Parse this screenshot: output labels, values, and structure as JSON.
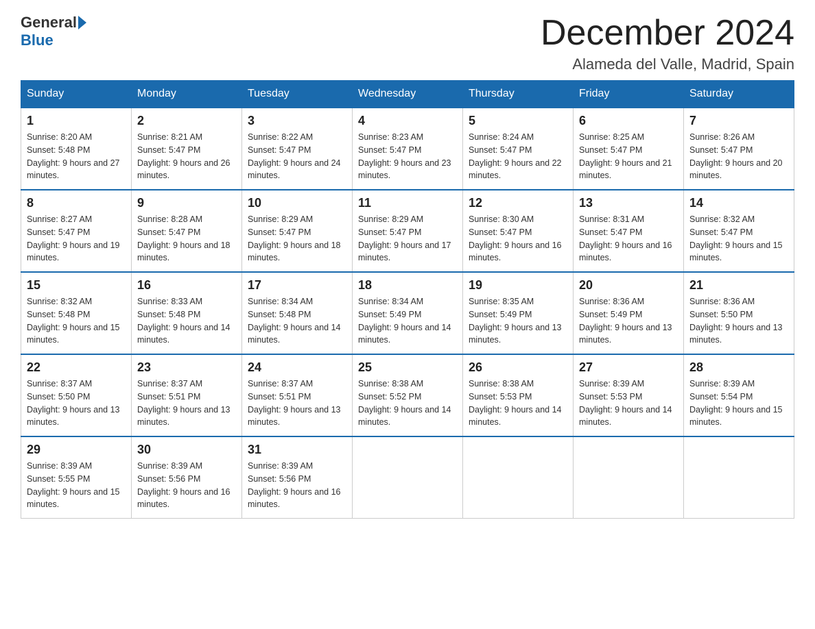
{
  "logo": {
    "general": "General",
    "blue": "Blue"
  },
  "title": "December 2024",
  "location": "Alameda del Valle, Madrid, Spain",
  "days_of_week": [
    "Sunday",
    "Monday",
    "Tuesday",
    "Wednesday",
    "Thursday",
    "Friday",
    "Saturday"
  ],
  "weeks": [
    [
      {
        "day": "1",
        "sunrise": "8:20 AM",
        "sunset": "5:48 PM",
        "daylight": "9 hours and 27 minutes."
      },
      {
        "day": "2",
        "sunrise": "8:21 AM",
        "sunset": "5:47 PM",
        "daylight": "9 hours and 26 minutes."
      },
      {
        "day": "3",
        "sunrise": "8:22 AM",
        "sunset": "5:47 PM",
        "daylight": "9 hours and 24 minutes."
      },
      {
        "day": "4",
        "sunrise": "8:23 AM",
        "sunset": "5:47 PM",
        "daylight": "9 hours and 23 minutes."
      },
      {
        "day": "5",
        "sunrise": "8:24 AM",
        "sunset": "5:47 PM",
        "daylight": "9 hours and 22 minutes."
      },
      {
        "day": "6",
        "sunrise": "8:25 AM",
        "sunset": "5:47 PM",
        "daylight": "9 hours and 21 minutes."
      },
      {
        "day": "7",
        "sunrise": "8:26 AM",
        "sunset": "5:47 PM",
        "daylight": "9 hours and 20 minutes."
      }
    ],
    [
      {
        "day": "8",
        "sunrise": "8:27 AM",
        "sunset": "5:47 PM",
        "daylight": "9 hours and 19 minutes."
      },
      {
        "day": "9",
        "sunrise": "8:28 AM",
        "sunset": "5:47 PM",
        "daylight": "9 hours and 18 minutes."
      },
      {
        "day": "10",
        "sunrise": "8:29 AM",
        "sunset": "5:47 PM",
        "daylight": "9 hours and 18 minutes."
      },
      {
        "day": "11",
        "sunrise": "8:29 AM",
        "sunset": "5:47 PM",
        "daylight": "9 hours and 17 minutes."
      },
      {
        "day": "12",
        "sunrise": "8:30 AM",
        "sunset": "5:47 PM",
        "daylight": "9 hours and 16 minutes."
      },
      {
        "day": "13",
        "sunrise": "8:31 AM",
        "sunset": "5:47 PM",
        "daylight": "9 hours and 16 minutes."
      },
      {
        "day": "14",
        "sunrise": "8:32 AM",
        "sunset": "5:47 PM",
        "daylight": "9 hours and 15 minutes."
      }
    ],
    [
      {
        "day": "15",
        "sunrise": "8:32 AM",
        "sunset": "5:48 PM",
        "daylight": "9 hours and 15 minutes."
      },
      {
        "day": "16",
        "sunrise": "8:33 AM",
        "sunset": "5:48 PM",
        "daylight": "9 hours and 14 minutes."
      },
      {
        "day": "17",
        "sunrise": "8:34 AM",
        "sunset": "5:48 PM",
        "daylight": "9 hours and 14 minutes."
      },
      {
        "day": "18",
        "sunrise": "8:34 AM",
        "sunset": "5:49 PM",
        "daylight": "9 hours and 14 minutes."
      },
      {
        "day": "19",
        "sunrise": "8:35 AM",
        "sunset": "5:49 PM",
        "daylight": "9 hours and 13 minutes."
      },
      {
        "day": "20",
        "sunrise": "8:36 AM",
        "sunset": "5:49 PM",
        "daylight": "9 hours and 13 minutes."
      },
      {
        "day": "21",
        "sunrise": "8:36 AM",
        "sunset": "5:50 PM",
        "daylight": "9 hours and 13 minutes."
      }
    ],
    [
      {
        "day": "22",
        "sunrise": "8:37 AM",
        "sunset": "5:50 PM",
        "daylight": "9 hours and 13 minutes."
      },
      {
        "day": "23",
        "sunrise": "8:37 AM",
        "sunset": "5:51 PM",
        "daylight": "9 hours and 13 minutes."
      },
      {
        "day": "24",
        "sunrise": "8:37 AM",
        "sunset": "5:51 PM",
        "daylight": "9 hours and 13 minutes."
      },
      {
        "day": "25",
        "sunrise": "8:38 AM",
        "sunset": "5:52 PM",
        "daylight": "9 hours and 14 minutes."
      },
      {
        "day": "26",
        "sunrise": "8:38 AM",
        "sunset": "5:53 PM",
        "daylight": "9 hours and 14 minutes."
      },
      {
        "day": "27",
        "sunrise": "8:39 AM",
        "sunset": "5:53 PM",
        "daylight": "9 hours and 14 minutes."
      },
      {
        "day": "28",
        "sunrise": "8:39 AM",
        "sunset": "5:54 PM",
        "daylight": "9 hours and 15 minutes."
      }
    ],
    [
      {
        "day": "29",
        "sunrise": "8:39 AM",
        "sunset": "5:55 PM",
        "daylight": "9 hours and 15 minutes."
      },
      {
        "day": "30",
        "sunrise": "8:39 AM",
        "sunset": "5:56 PM",
        "daylight": "9 hours and 16 minutes."
      },
      {
        "day": "31",
        "sunrise": "8:39 AM",
        "sunset": "5:56 PM",
        "daylight": "9 hours and 16 minutes."
      },
      null,
      null,
      null,
      null
    ]
  ]
}
